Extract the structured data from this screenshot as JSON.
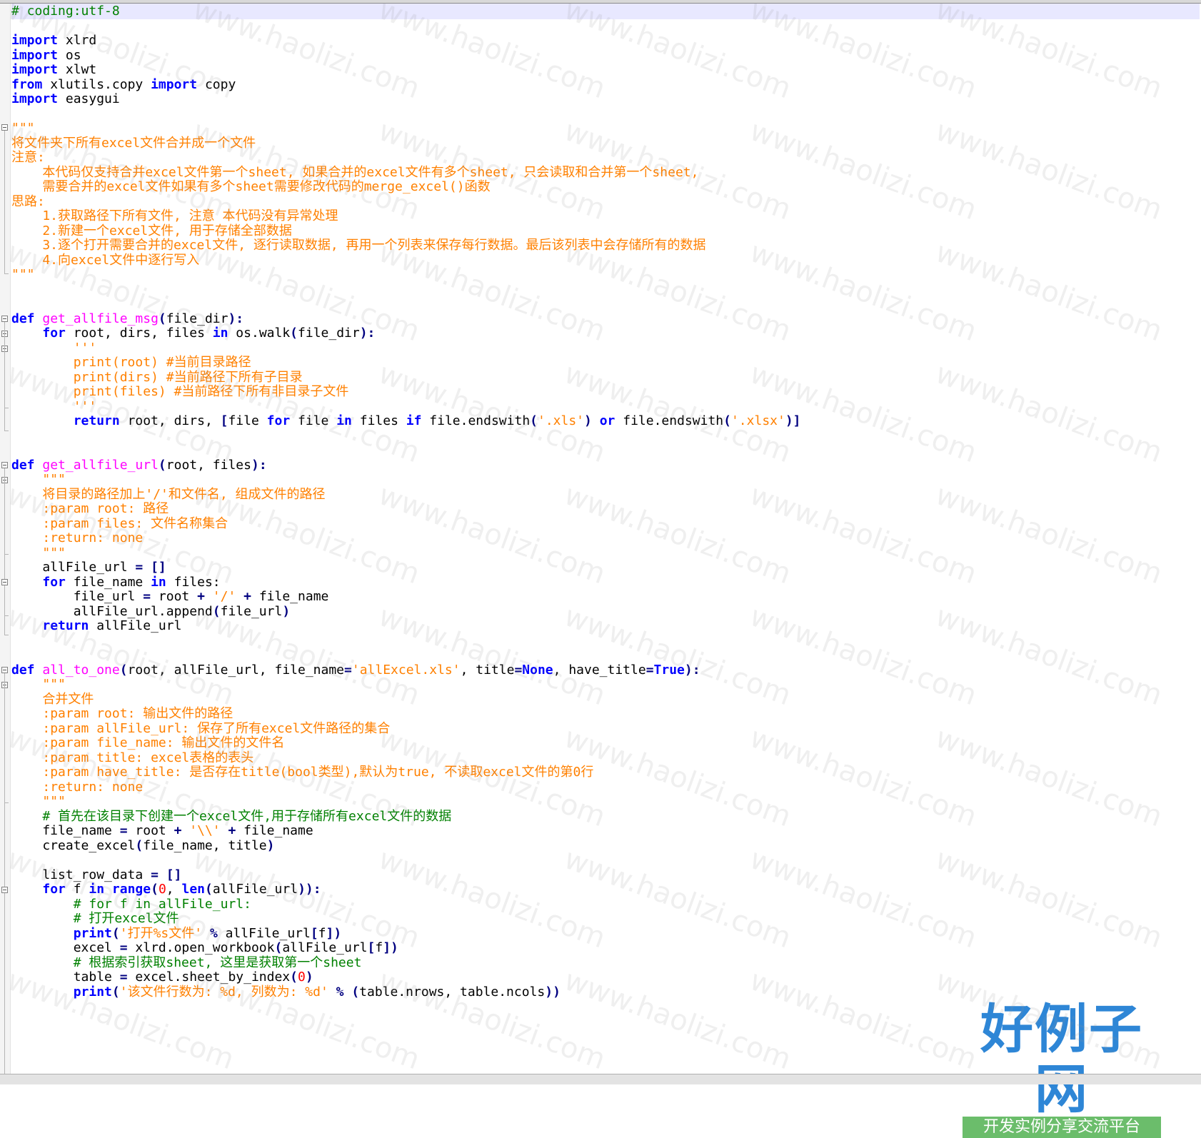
{
  "editor": {
    "lines": [
      [
        [
          "cm",
          "# coding:utf-8"
        ]
      ],
      [],
      [
        [
          "kw",
          "import"
        ],
        [
          "",
          " xlrd"
        ]
      ],
      [
        [
          "kw",
          "import"
        ],
        [
          "",
          " os"
        ]
      ],
      [
        [
          "kw",
          "import"
        ],
        [
          "",
          " xlwt"
        ]
      ],
      [
        [
          "kw",
          "from"
        ],
        [
          "",
          " xlutils.copy "
        ],
        [
          "kw",
          "import"
        ],
        [
          "",
          " copy"
        ]
      ],
      [
        [
          "kw",
          "import"
        ],
        [
          "",
          " easygui"
        ]
      ],
      [],
      [
        [
          "st",
          "\"\"\""
        ]
      ],
      [
        [
          "st",
          "将文件夹下所有excel文件合并成一个文件"
        ]
      ],
      [
        [
          "st",
          "注意:"
        ]
      ],
      [
        [
          "st",
          "    本代码仅支持合并excel文件第一个sheet, 如果合并的excel文件有多个sheet, 只会读取和合并第一个sheet,"
        ]
      ],
      [
        [
          "st",
          "    需要合并的excel文件如果有多个sheet需要修改代码的merge_excel()函数"
        ]
      ],
      [
        [
          "st",
          "思路:"
        ]
      ],
      [
        [
          "st",
          "    1.获取路径下所有文件, 注意 本代码没有异常处理"
        ]
      ],
      [
        [
          "st",
          "    2.新建一个excel文件, 用于存储全部数据"
        ]
      ],
      [
        [
          "st",
          "    3.逐个打开需要合并的excel文件, 逐行读取数据, 再用一个列表来保存每行数据。最后该列表中会存储所有的数据"
        ]
      ],
      [
        [
          "st",
          "    4.向excel文件中逐行写入"
        ]
      ],
      [
        [
          "st",
          "\"\"\""
        ]
      ],
      [],
      [],
      [
        [
          "kw",
          "def"
        ],
        [
          "",
          " "
        ],
        [
          "fn",
          "get_allfile_msg"
        ],
        [
          "op",
          "("
        ],
        [
          "",
          "file_dir"
        ],
        [
          "op",
          "):"
        ]
      ],
      [
        [
          "",
          "    "
        ],
        [
          "kw",
          "for"
        ],
        [
          "",
          " root, dirs, files "
        ],
        [
          "kw",
          "in"
        ],
        [
          "",
          " os.walk"
        ],
        [
          "op",
          "("
        ],
        [
          "",
          "file_dir"
        ],
        [
          "op",
          "):"
        ]
      ],
      [
        [
          "",
          "        "
        ],
        [
          "st",
          "'''"
        ]
      ],
      [
        [
          "",
          "        "
        ],
        [
          "st",
          "print(root) #当前目录路径"
        ]
      ],
      [
        [
          "",
          "        "
        ],
        [
          "st",
          "print(dirs) #当前路径下所有子目录"
        ]
      ],
      [
        [
          "",
          "        "
        ],
        [
          "st",
          "print(files) #当前路径下所有非目录子文件"
        ]
      ],
      [
        [
          "",
          "        "
        ],
        [
          "st",
          "'''"
        ]
      ],
      [
        [
          "",
          "        "
        ],
        [
          "kw",
          "return"
        ],
        [
          "",
          " root, dirs, "
        ],
        [
          "op",
          "["
        ],
        [
          "",
          "file "
        ],
        [
          "kw",
          "for"
        ],
        [
          "",
          " file "
        ],
        [
          "kw",
          "in"
        ],
        [
          "",
          " files "
        ],
        [
          "kw",
          "if"
        ],
        [
          "",
          " file.endswith"
        ],
        [
          "op",
          "("
        ],
        [
          "st",
          "'.xls'"
        ],
        [
          "op",
          ")"
        ],
        [
          "",
          " "
        ],
        [
          "kw",
          "or"
        ],
        [
          "",
          " file.endswith"
        ],
        [
          "op",
          "("
        ],
        [
          "st",
          "'.xlsx'"
        ],
        [
          "op",
          ")]"
        ]
      ],
      [],
      [],
      [
        [
          "kw",
          "def"
        ],
        [
          "",
          " "
        ],
        [
          "fn",
          "get_allfile_url"
        ],
        [
          "op",
          "("
        ],
        [
          "",
          "root, files"
        ],
        [
          "op",
          "):"
        ]
      ],
      [
        [
          "",
          "    "
        ],
        [
          "st",
          "\"\"\""
        ]
      ],
      [
        [
          "",
          "    "
        ],
        [
          "st",
          "将目录的路径加上'/'和文件名, 组成文件的路径"
        ]
      ],
      [
        [
          "",
          "    "
        ],
        [
          "st",
          ":param root: 路径"
        ]
      ],
      [
        [
          "",
          "    "
        ],
        [
          "st",
          ":param files: 文件名称集合"
        ]
      ],
      [
        [
          "",
          "    "
        ],
        [
          "st",
          ":return: none"
        ]
      ],
      [
        [
          "",
          "    "
        ],
        [
          "st",
          "\"\"\""
        ]
      ],
      [
        [
          "",
          "    allFile_url "
        ],
        [
          "op",
          "="
        ],
        [
          "",
          " "
        ],
        [
          "op",
          "[]"
        ]
      ],
      [
        [
          "",
          "    "
        ],
        [
          "kw",
          "for"
        ],
        [
          "",
          " file_name "
        ],
        [
          "kw",
          "in"
        ],
        [
          "",
          " files:"
        ]
      ],
      [
        [
          "",
          "        file_url "
        ],
        [
          "op",
          "="
        ],
        [
          "",
          " root "
        ],
        [
          "op",
          "+"
        ],
        [
          "",
          " "
        ],
        [
          "st",
          "'/'"
        ],
        [
          "",
          " "
        ],
        [
          "op",
          "+"
        ],
        [
          "",
          " file_name"
        ]
      ],
      [
        [
          "",
          "        allFile_url.append"
        ],
        [
          "op",
          "("
        ],
        [
          "",
          "file_url"
        ],
        [
          "op",
          ")"
        ]
      ],
      [
        [
          "",
          "    "
        ],
        [
          "kw",
          "return"
        ],
        [
          "",
          " allFile_url"
        ]
      ],
      [],
      [],
      [
        [
          "kw",
          "def"
        ],
        [
          "",
          " "
        ],
        [
          "fn",
          "all_to_one"
        ],
        [
          "op",
          "("
        ],
        [
          "",
          "root, allFile_url, file_name"
        ],
        [
          "op",
          "="
        ],
        [
          "st",
          "'allExcel.xls'"
        ],
        [
          "",
          ", title"
        ],
        [
          "op",
          "="
        ],
        [
          "kw",
          "None"
        ],
        [
          "",
          ", have_title"
        ],
        [
          "op",
          "="
        ],
        [
          "kw",
          "True"
        ],
        [
          "op",
          "):"
        ]
      ],
      [
        [
          "",
          "    "
        ],
        [
          "st",
          "\"\"\""
        ]
      ],
      [
        [
          "",
          "    "
        ],
        [
          "st",
          "合并文件"
        ]
      ],
      [
        [
          "",
          "    "
        ],
        [
          "st",
          ":param root: 输出文件的路径"
        ]
      ],
      [
        [
          "",
          "    "
        ],
        [
          "st",
          ":param allFile_url: 保存了所有excel文件路径的集合"
        ]
      ],
      [
        [
          "",
          "    "
        ],
        [
          "st",
          ":param file_name: 输出文件的文件名"
        ]
      ],
      [
        [
          "",
          "    "
        ],
        [
          "st",
          ":param title: excel表格的表头"
        ]
      ],
      [
        [
          "",
          "    "
        ],
        [
          "st",
          ":param have_title: 是否存在title(bool类型),默认为true, 不读取excel文件的第0行"
        ]
      ],
      [
        [
          "",
          "    "
        ],
        [
          "st",
          ":return: none"
        ]
      ],
      [
        [
          "",
          "    "
        ],
        [
          "st",
          "\"\"\""
        ]
      ],
      [
        [
          "",
          "    "
        ],
        [
          "cm",
          "# 首先在该目录下创建一个excel文件,用于存储所有excel文件的数据"
        ]
      ],
      [
        [
          "",
          "    file_name "
        ],
        [
          "op",
          "="
        ],
        [
          "",
          " root "
        ],
        [
          "op",
          "+"
        ],
        [
          "",
          " "
        ],
        [
          "st",
          "'\\\\'"
        ],
        [
          "",
          " "
        ],
        [
          "op",
          "+"
        ],
        [
          "",
          " file_name"
        ]
      ],
      [
        [
          "",
          "    create_excel"
        ],
        [
          "op",
          "("
        ],
        [
          "",
          "file_name, title"
        ],
        [
          "op",
          ")"
        ]
      ],
      [],
      [
        [
          "",
          "    list_row_data "
        ],
        [
          "op",
          "="
        ],
        [
          "",
          " "
        ],
        [
          "op",
          "[]"
        ]
      ],
      [
        [
          "",
          "    "
        ],
        [
          "kw",
          "for"
        ],
        [
          "",
          " f "
        ],
        [
          "kw",
          "in"
        ],
        [
          "",
          " "
        ],
        [
          "kw",
          "range"
        ],
        [
          "op",
          "("
        ],
        [
          "nm",
          "0"
        ],
        [
          "",
          ", "
        ],
        [
          "kw",
          "len"
        ],
        [
          "op",
          "("
        ],
        [
          "",
          "allFile_url"
        ],
        [
          "op",
          ")):"
        ]
      ],
      [
        [
          "",
          "        "
        ],
        [
          "cm",
          "# for f in allFile_url:"
        ]
      ],
      [
        [
          "",
          "        "
        ],
        [
          "cm",
          "# 打开excel文件"
        ]
      ],
      [
        [
          "",
          "        "
        ],
        [
          "kw",
          "print"
        ],
        [
          "op",
          "("
        ],
        [
          "st",
          "'打开%s文件'"
        ],
        [
          "",
          " "
        ],
        [
          "op",
          "%"
        ],
        [
          "",
          " allFile_url"
        ],
        [
          "op",
          "["
        ],
        [
          "",
          "f"
        ],
        [
          "op",
          "])"
        ]
      ],
      [
        [
          "",
          "        excel "
        ],
        [
          "op",
          "="
        ],
        [
          "",
          " xlrd.open_workbook"
        ],
        [
          "op",
          "("
        ],
        [
          "",
          "allFile_url"
        ],
        [
          "op",
          "["
        ],
        [
          "",
          "f"
        ],
        [
          "op",
          "])"
        ]
      ],
      [
        [
          "",
          "        "
        ],
        [
          "cm",
          "# 根据索引获取sheet, 这里是获取第一个sheet"
        ]
      ],
      [
        [
          "",
          "        table "
        ],
        [
          "op",
          "="
        ],
        [
          "",
          " excel.sheet_by_index"
        ],
        [
          "op",
          "("
        ],
        [
          "nm",
          "0"
        ],
        [
          "op",
          ")"
        ]
      ],
      [
        [
          "",
          "        "
        ],
        [
          "kw",
          "print"
        ],
        [
          "op",
          "("
        ],
        [
          "st",
          "'该文件行数为: %d, 列数为: %d'"
        ],
        [
          "",
          " "
        ],
        [
          "op",
          "%"
        ],
        [
          "",
          " "
        ],
        [
          "op",
          "("
        ],
        [
          "",
          "table.nrows, table.ncols"
        ],
        [
          "op",
          "))"
        ]
      ]
    ]
  },
  "watermark_text": "www.haolizi.com",
  "logo": {
    "title": "好例子网",
    "subtitle": "开发实例分享交流平台"
  },
  "colors": {
    "keyword": "#0000ff",
    "string": "#ff8000",
    "comment": "#008000",
    "function_name": "#ff00ff",
    "number": "#ff0000",
    "operator": "#000080",
    "current_line": "#e8e8ff",
    "logo_blue": "#2e86d6",
    "logo_green": "#6bbd6b"
  }
}
